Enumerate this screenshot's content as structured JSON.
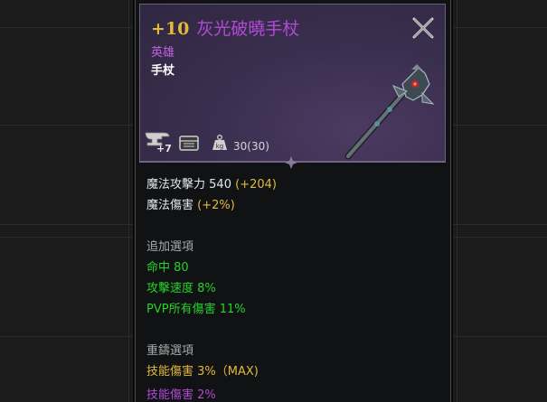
{
  "item": {
    "enhance": "+10",
    "name": "灰光破曉手杖",
    "grade": "英雄",
    "type": "手杖",
    "enhance_count": "+7",
    "weight": "30(30)"
  },
  "stats": {
    "magic_attack_label": "魔法攻擊力",
    "magic_attack_value": "540",
    "magic_attack_bonus": "(+204)",
    "magic_damage_label": "魔法傷害",
    "magic_damage_bonus": "(+2%)"
  },
  "additional": {
    "header": "追加選項",
    "lines": [
      "命中 80",
      "攻擊速度 8%",
      "PVP所有傷害 11%"
    ]
  },
  "recast": {
    "header": "重鑄選項",
    "line1": "技能傷害 3%（MAX)",
    "line2": "技能傷害 2%"
  },
  "colors": {
    "enhance": "#e3b93a",
    "name": "#b24ad6",
    "green": "#29d12b",
    "gold": "#e3b93a",
    "purple": "#b24ad6"
  },
  "icons": [
    "anvil-icon",
    "chest-icon",
    "weight-icon",
    "close-icon",
    "staff-icon"
  ]
}
